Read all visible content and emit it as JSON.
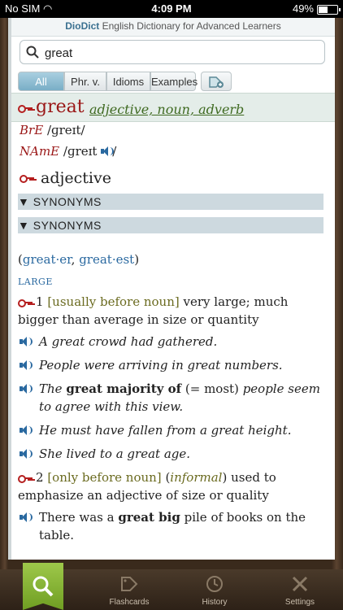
{
  "status": {
    "carrier": "No SIM",
    "time": "4:09 PM",
    "battery": "49%"
  },
  "app": {
    "title_brand": "DioDict",
    "title_rest": "English Dictionary for Advanced Learners"
  },
  "search": {
    "value": "great"
  },
  "tabs": [
    "All",
    "Phr. v.",
    "Idioms",
    "Examples"
  ],
  "entry": {
    "headword": "great",
    "pos_list": "adjective, noun, adverb",
    "bre_label": "BrE",
    "bre_pron": "/ɡreɪt/",
    "name_label": "NAmE",
    "name_pron": "/ɡreɪt",
    "name_slash": "/",
    "pos": "adjective",
    "synonyms_1": "▼ SYNONYMS",
    "synonyms_2": "▼ SYNONYMS",
    "infl_open": "(",
    "infl_1": "great·er",
    "infl_sep": ", ",
    "infl_2": "great·est",
    "infl_close": ")",
    "section": "LARGE",
    "sense1_num": "1",
    "sense1_gram": "[usually before noun]",
    "sense1_def": "very large; much bigger than average in size or quantity",
    "ex1": "A great crowd had gathered.",
    "ex2": "People were arriving in great numbers.",
    "ex3_a": "The",
    "ex3_b": "great majority of",
    "ex3_c": "(= most)",
    "ex3_d": "people seem to agree with this view.",
    "ex4": "He must have fallen from a great height.",
    "ex5": "She lived to a great age.",
    "sense2_num": "2",
    "sense2_gram": "[only before noun]",
    "sense2_reg_open": "(",
    "sense2_reg": "informal",
    "sense2_reg_close": ")",
    "sense2_def": "used to emphasize an adjective of size or quality",
    "ex6_a": "There was a",
    "ex6_b": "great big",
    "ex6_c": "pile of books on the table."
  },
  "tabbar": {
    "flashcards": "Flashcards",
    "history": "History",
    "settings": "Settings"
  },
  "colors": {
    "accent": "#2a69a0",
    "headword": "#9a1616",
    "tab_active": "#79aec6",
    "search_tab": "#8ab83a"
  }
}
